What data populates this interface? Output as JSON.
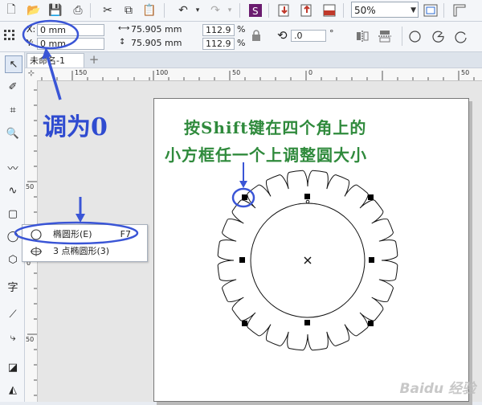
{
  "toolbar": {
    "zoom_value": "50%"
  },
  "property_bar": {
    "x_label": "X:",
    "x_value": "0 mm",
    "y_label": "Y:",
    "y_value": "0 mm",
    "width_value": "75.905 mm",
    "height_value": "75.905 mm",
    "scale_x": "112.9",
    "scale_y": "112.9",
    "percent_unit": "%",
    "rotation_value": ".0",
    "rotation_unit": "°"
  },
  "tabs": {
    "document_tab": "未命名-1",
    "add_tab": "+"
  },
  "ruler": {
    "h_ticks": [
      "150",
      "100",
      "50",
      "0",
      "50"
    ],
    "v_ticks": [
      "50",
      "0",
      "50"
    ]
  },
  "flyout_menu": {
    "items": [
      {
        "label": "椭圆形(E)",
        "shortcut": "F7"
      },
      {
        "label": "3 点椭圆形(3)",
        "shortcut": ""
      }
    ]
  },
  "annotations": {
    "set_to_zero": "调为0",
    "instruction_line1": "按Shift键在四个角上的",
    "instruction_line2": "小方框任一个上调整圆大小"
  },
  "watermark": "Baidu 经验",
  "colors": {
    "annotation_blue": "#2f4bd0",
    "annotation_green": "#2f8a3c",
    "highlight_ring": "#3a55d6"
  }
}
